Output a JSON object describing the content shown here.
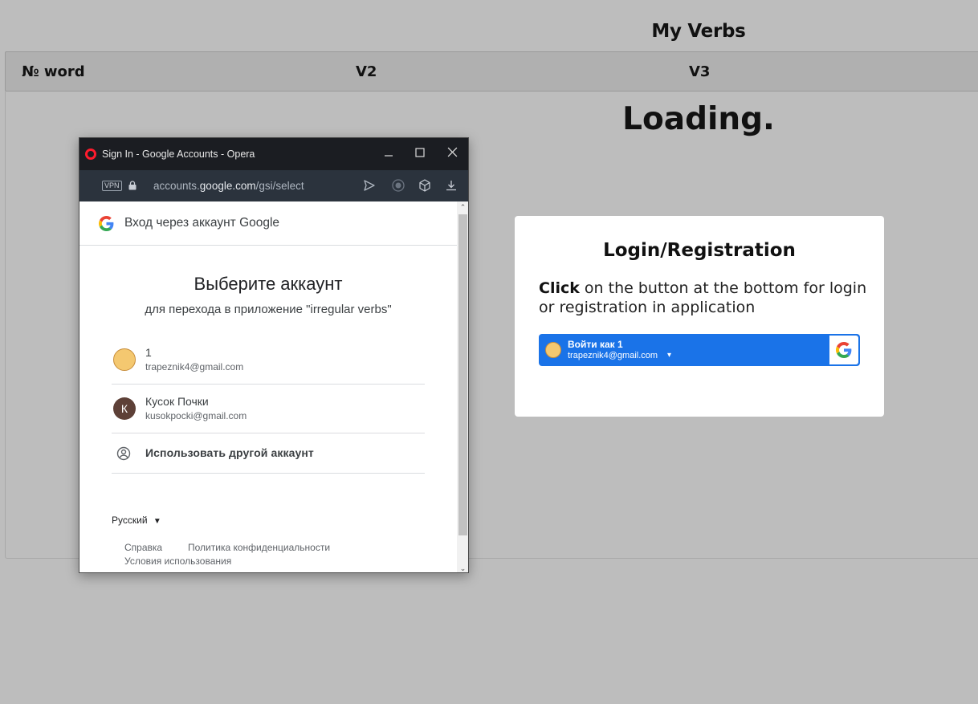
{
  "app": {
    "title": "My Verbs",
    "columns": [
      "№ word",
      "V2",
      "V3"
    ],
    "loading": "Loading."
  },
  "login": {
    "title": "Login/Registration",
    "text_bold": "Click",
    "text_rest": " on the button at the bottom for login or registration in application",
    "button_name": "Войти как 1",
    "button_email": "trapeznik4@gmail.com",
    "brand_color": "#1a73e8"
  },
  "popup": {
    "window_title": "Sign In - Google Accounts - Opera",
    "vpn_label": "VPN",
    "url_pre": "accounts.",
    "url_domain": "google.com",
    "url_path": "/gsi/select",
    "header": "Вход через аккаунт Google",
    "choose_title": "Выберите аккаунт",
    "choose_sub": "для перехода в приложение \"irregular verbs\"",
    "accounts": [
      {
        "name": "1",
        "email": "trapeznik4@gmail.com",
        "avatar_letter": ""
      },
      {
        "name": "Кусок Почки",
        "email": "kusokpocki@gmail.com",
        "avatar_letter": "К"
      }
    ],
    "other_account": "Использовать другой аккаунт",
    "language": "Русский",
    "footer_links": [
      "Справка",
      "Политика конфиденциальности",
      "Условия использования"
    ]
  }
}
